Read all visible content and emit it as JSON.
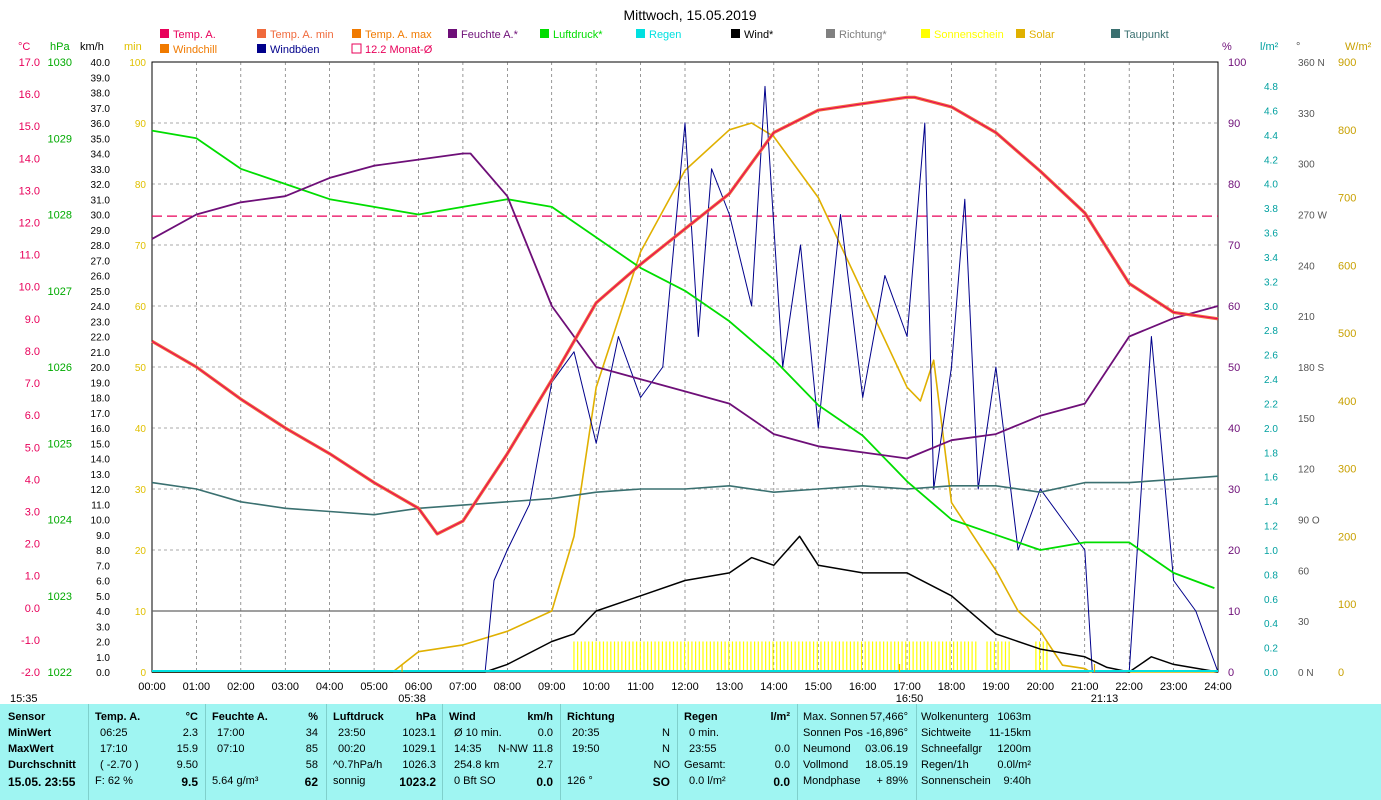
{
  "chart_data": {
    "type": "line",
    "title": "Mittwoch, 15.05.2019",
    "legend": [
      {
        "name": "Temp. A.",
        "color": "#e8005a"
      },
      {
        "name": "Temp. A. min",
        "color": "#f06a3c"
      },
      {
        "name": "Temp. A. max",
        "color": "#f07a00"
      },
      {
        "name": "Feuchte A.*",
        "color": "#6e0f78"
      },
      {
        "name": "Luftdruck*",
        "color": "#00dd00"
      },
      {
        "name": "Regen",
        "color": "#00e0e0"
      },
      {
        "name": "Wind*",
        "color": "#000000"
      },
      {
        "name": "Richtung*",
        "color": "#808080"
      },
      {
        "name": "Sonnenschein",
        "color": "#ffff00"
      },
      {
        "name": "Solar",
        "color": "#e0b000"
      },
      {
        "name": "Taupunkt",
        "color": "#3a7070"
      },
      {
        "name": "Windchill",
        "color": "#f07a00"
      },
      {
        "name": "Windböen",
        "color": "#00008b"
      },
      {
        "name": "12.2 Monat-Ø",
        "color": "#e8005a"
      }
    ],
    "axis_units": [
      "°C",
      "hPa",
      "km/h",
      "min",
      "%",
      "l/m²",
      "°",
      "W/m²"
    ],
    "x_ticks": [
      "00:00",
      "01:00",
      "02:00",
      "03:00",
      "04:00",
      "05:00",
      "06:00",
      "07:00",
      "08:00",
      "09:00",
      "10:00",
      "11:00",
      "12:00",
      "13:00",
      "14:00",
      "15:00",
      "16:00",
      "17:00",
      "18:00",
      "19:00",
      "20:00",
      "21:00",
      "22:00",
      "23:00",
      "24:00"
    ],
    "temp_ticks": [
      "17.0",
      "16.0",
      "15.0",
      "14.0",
      "13.0",
      "12.0",
      "11.0",
      "10.0",
      "9.0",
      "8.0",
      "7.0",
      "6.0",
      "5.0",
      "4.0",
      "3.0",
      "2.0",
      "1.0",
      "0.0",
      "-1.0",
      "-2.0"
    ],
    "hpa_ticks": [
      "1030",
      "1029",
      "1028",
      "1027",
      "1026",
      "1025",
      "1024",
      "1023",
      "1022"
    ],
    "kmh_ticks": [
      "40.0",
      "39.0",
      "38.0",
      "37.0",
      "36.0",
      "35.0",
      "34.0",
      "33.0",
      "32.0",
      "31.0",
      "30.0",
      "29.0",
      "28.0",
      "27.0",
      "26.0",
      "25.0",
      "24.0",
      "23.0",
      "22.0",
      "21.0",
      "20.0",
      "19.0",
      "18.0",
      "17.0",
      "16.0",
      "15.0",
      "14.0",
      "13.0",
      "12.0",
      "11.0",
      "10.0",
      "9.0",
      "8.0",
      "7.0",
      "6.0",
      "5.0",
      "4.0",
      "3.0",
      "2.0",
      "1.0",
      "0.0"
    ],
    "min_ticks": [
      "100",
      "90",
      "80",
      "70",
      "60",
      "50",
      "40",
      "30",
      "20",
      "10",
      "0"
    ],
    "pct_ticks": [
      "100",
      "90",
      "80",
      "70",
      "60",
      "50",
      "40",
      "30",
      "20",
      "10",
      "0"
    ],
    "rain_ticks": [
      "4.8",
      "4.6",
      "4.4",
      "4.2",
      "4.0",
      "3.8",
      "3.6",
      "3.4",
      "3.2",
      "3.0",
      "2.8",
      "2.6",
      "2.4",
      "2.2",
      "2.0",
      "1.8",
      "1.6",
      "1.4",
      "1.2",
      "1.0",
      "0.8",
      "0.6",
      "0.4",
      "0.2",
      "0.0"
    ],
    "deg_ticks": [
      "360 N",
      "330",
      "300",
      "270 W",
      "240",
      "210",
      "180 S",
      "150",
      "120",
      "90 O",
      "60",
      "30",
      "0 N"
    ],
    "wm2_ticks": [
      "900",
      "800",
      "700",
      "600",
      "500",
      "400",
      "300",
      "200",
      "100",
      "0"
    ],
    "month_avg_temp": 12.2,
    "temperature": {
      "x": [
        0,
        1,
        2,
        3,
        4,
        5,
        6,
        6.42,
        7,
        8,
        9,
        10,
        11,
        12,
        13,
        14,
        15,
        16,
        17,
        17.17,
        18,
        19,
        20,
        21,
        22,
        23,
        24
      ],
      "y": [
        8.3,
        7.5,
        6.5,
        5.6,
        4.8,
        3.9,
        3.1,
        2.3,
        2.7,
        4.8,
        7.1,
        9.5,
        10.7,
        11.8,
        12.9,
        14.8,
        15.5,
        15.7,
        15.9,
        15.9,
        15.6,
        14.8,
        13.6,
        12.3,
        10.1,
        9.2,
        9.0
      ]
    },
    "humidity": {
      "x": [
        0,
        1,
        2,
        3,
        4,
        5,
        6,
        7,
        7.17,
        8,
        9,
        10,
        11,
        12,
        13,
        14,
        15,
        16,
        17,
        18,
        19,
        20,
        21,
        22,
        23,
        24
      ],
      "y": [
        71,
        75,
        77,
        78,
        81,
        83,
        84,
        85,
        85,
        78,
        60,
        50,
        48,
        46,
        44,
        39,
        37,
        36,
        35,
        38,
        39,
        42,
        44,
        55,
        58,
        60
      ]
    },
    "pressure": {
      "x": [
        0,
        1,
        2,
        3,
        4,
        5,
        6,
        7,
        8,
        9,
        10,
        11,
        12,
        13,
        14,
        15,
        16,
        17,
        18,
        19,
        20,
        21,
        22,
        23,
        23.92
      ],
      "y": [
        1029.1,
        1029.0,
        1028.6,
        1028.4,
        1028.2,
        1028.1,
        1028.0,
        1028.1,
        1028.2,
        1028.1,
        1027.7,
        1027.3,
        1027.0,
        1026.6,
        1026.1,
        1025.5,
        1025.1,
        1024.5,
        1024.0,
        1023.8,
        1023.6,
        1023.7,
        1023.7,
        1023.3,
        1023.1
      ]
    },
    "dew_point": {
      "x": [
        0,
        1,
        2,
        3,
        4,
        5,
        6,
        7,
        8,
        9,
        10,
        11,
        12,
        13,
        14,
        15,
        16,
        17,
        18,
        19,
        20,
        21,
        22,
        23,
        24
      ],
      "y": [
        3.9,
        3.7,
        3.3,
        3.1,
        3.0,
        2.9,
        3.1,
        3.2,
        3.3,
        3.4,
        3.6,
        3.7,
        3.7,
        3.8,
        3.6,
        3.7,
        3.8,
        3.7,
        3.8,
        3.8,
        3.6,
        3.9,
        3.9,
        4.0,
        4.1
      ]
    },
    "wind": {
      "x": [
        0,
        7.5,
        8,
        9,
        9.5,
        10,
        11,
        12,
        13,
        13.5,
        14,
        14.58,
        15,
        16,
        17,
        18,
        19,
        20,
        21,
        21.5,
        22,
        22.5,
        23,
        24
      ],
      "y": [
        0,
        0,
        0.5,
        2.0,
        2.5,
        4.0,
        5.0,
        6.0,
        6.5,
        7.5,
        7.0,
        8.9,
        7.0,
        6.5,
        6.5,
        5.0,
        2.5,
        1.5,
        1.0,
        0.3,
        0,
        1.0,
        0.5,
        0
      ]
    },
    "gusts": {
      "x": [
        0,
        7.5,
        7.7,
        8,
        8.5,
        9,
        9.5,
        10,
        10.5,
        11,
        11.5,
        12,
        12.3,
        12.6,
        13,
        13.5,
        13.8,
        14.2,
        14.6,
        15,
        15.5,
        16,
        16.5,
        17,
        17.4,
        17.6,
        18,
        18.3,
        18.6,
        19,
        19.5,
        20,
        20.5,
        21,
        21.17,
        22,
        22.5,
        23,
        23.5,
        24
      ],
      "y": [
        0,
        0,
        6.0,
        8.0,
        11.0,
        19.0,
        21.0,
        15.0,
        22.0,
        18.0,
        20.0,
        36.0,
        22.0,
        33.0,
        30.0,
        24.0,
        38.4,
        20.0,
        28.0,
        16.0,
        30.0,
        18.0,
        26.0,
        22.0,
        36.0,
        12.0,
        20.0,
        31.0,
        12.0,
        20.0,
        8.0,
        12.0,
        10.0,
        8.0,
        0,
        0,
        22.0,
        6.0,
        4.0,
        0
      ]
    },
    "solar": {
      "x": [
        0,
        5.42,
        6,
        7,
        8,
        9,
        9.5,
        10,
        11,
        12,
        13,
        13.5,
        14,
        15,
        16,
        17,
        17.3,
        17.6,
        18,
        18.5,
        19,
        19.5,
        20,
        20.5,
        21,
        21.13,
        22,
        24
      ],
      "y": [
        0,
        0,
        30,
        40,
        60,
        90,
        200,
        420,
        620,
        740,
        800,
        810,
        790,
        700,
        560,
        420,
        400,
        460,
        250,
        200,
        150,
        90,
        60,
        10,
        5,
        0,
        0,
        0
      ]
    },
    "sunshine": [
      {
        "start": 9.5,
        "end": 18.6
      },
      {
        "start": 18.8,
        "end": 19.3
      },
      {
        "start": 19.9,
        "end": 20.2
      }
    ],
    "events": [
      {
        "label": "05:38",
        "x": 5.63
      },
      {
        "label": "16:50",
        "x": 16.83
      },
      {
        "label": "21:13",
        "x": 21.22
      }
    ],
    "footer_left": "15:35"
  },
  "stats": {
    "col1": {
      "header": "Sensor",
      "rows": [
        "MinWert",
        "MaxWert",
        "Durchschnitt",
        "15.05. 23:55"
      ]
    },
    "col2": {
      "header": "Temp. A.",
      "unit": "°C",
      "rows": [
        [
          "06:25",
          "2.3"
        ],
        [
          "17:10",
          "15.9"
        ],
        [
          "( -2.70 )",
          "9.50"
        ],
        [
          "F: 62 %",
          "9.5"
        ]
      ]
    },
    "col3": {
      "header": "Feuchte A.",
      "unit": "%",
      "rows": [
        [
          "17:00",
          "34"
        ],
        [
          "07:10",
          "85"
        ],
        [
          "",
          "58"
        ],
        [
          "5.64 g/m³",
          "62"
        ]
      ]
    },
    "col4": {
      "header": "Luftdruck",
      "unit": "hPa",
      "rows": [
        [
          "23:50",
          "1023.1"
        ],
        [
          "00:20",
          "1029.1"
        ],
        [
          "^0.7hPa/h",
          "1026.3"
        ],
        [
          "sonnig",
          "1023.2"
        ]
      ]
    },
    "col5": {
      "header": "Wind",
      "unit": "km/h",
      "rows": [
        [
          "Ø 10 min.",
          "",
          "0.0"
        ],
        [
          "14:35",
          "N-NW",
          "11.8"
        ],
        [
          "254.8 km",
          "",
          "2.7"
        ],
        [
          "0 Bft SO",
          "",
          "0.0"
        ]
      ]
    },
    "col6": {
      "header": "Richtung",
      "rows": [
        [
          "20:35",
          "N"
        ],
        [
          "19:50",
          "N"
        ],
        [
          "",
          "NO"
        ],
        [
          "126 °",
          "SO"
        ]
      ]
    },
    "col7": {
      "header": "Regen",
      "unit": "l/m²",
      "rows": [
        [
          "0 min.",
          ""
        ],
        [
          "23:55",
          "0.0"
        ],
        [
          "Gesamt:",
          "0.0"
        ],
        [
          "0.0 l/m²",
          "0.0"
        ]
      ]
    },
    "col8": {
      "rows": [
        [
          "Max. Sonnen",
          "57,466°"
        ],
        [
          "Sonnen Pos",
          "-16,896°"
        ],
        [
          "Neumond",
          "03.06.19"
        ],
        [
          "Vollmond",
          "18.05.19"
        ],
        [
          "Mondphase",
          "+ 89%"
        ]
      ]
    },
    "col9": {
      "rows": [
        [
          "Wolkenunterg",
          "1063m"
        ],
        [
          "Sichtweite",
          "11-15km"
        ],
        [
          "Schneefallgr",
          "1200m"
        ],
        [
          "Regen/1h",
          "0.0l/m²"
        ],
        [
          "Sonnenschein",
          "9:40h"
        ]
      ]
    }
  }
}
